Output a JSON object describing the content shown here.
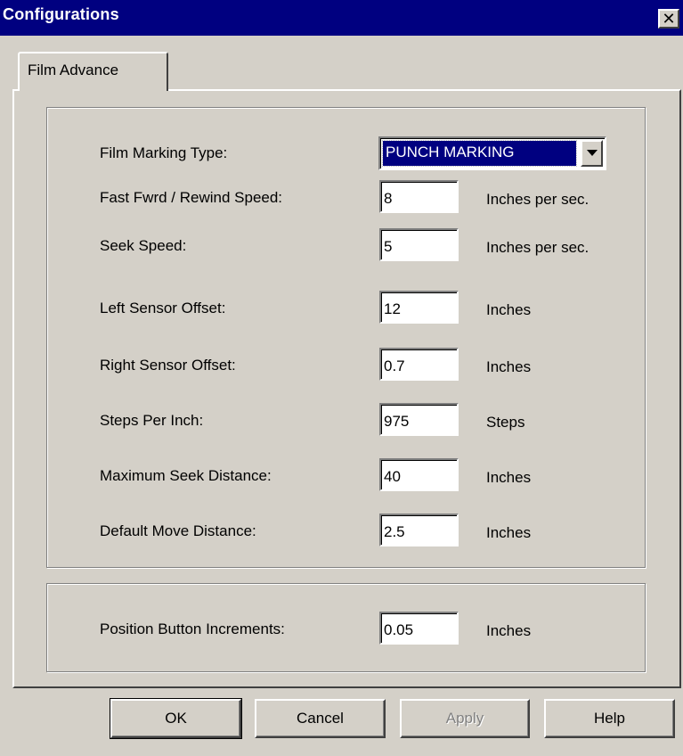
{
  "window": {
    "title": "Configurations",
    "close_glyph": "✕"
  },
  "tab": {
    "label": "Film Advance"
  },
  "film_marking": {
    "label": "Film Marking Type:",
    "value": "PUNCH MARKING"
  },
  "fields": [
    {
      "label": "Fast Fwrd / Rewind Speed:",
      "value": "8",
      "unit": "Inches per sec."
    },
    {
      "label": "Seek Speed:",
      "value": "5",
      "unit": "Inches per sec."
    },
    {
      "label": "Left Sensor Offset:",
      "value": "12",
      "unit": "Inches"
    },
    {
      "label": "Right Sensor Offset:",
      "value": "0.7",
      "unit": "Inches"
    },
    {
      "label": "Steps Per Inch:",
      "value": "975",
      "unit": "Steps"
    },
    {
      "label": "Maximum Seek Distance:",
      "value": "40",
      "unit": "Inches"
    },
    {
      "label": "Default Move Distance:",
      "value": "2.5",
      "unit": "Inches"
    }
  ],
  "position_increment": {
    "label": "Position Button Increments:",
    "value": "0.05",
    "unit": "Inches"
  },
  "buttons": {
    "ok": "OK",
    "cancel": "Cancel",
    "apply": "Apply",
    "help": "Help"
  }
}
